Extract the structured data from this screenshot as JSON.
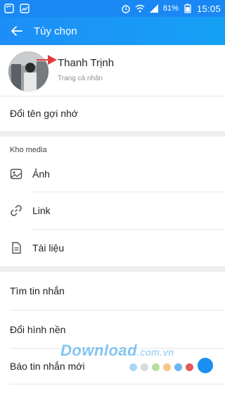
{
  "status_bar": {
    "battery": "81%",
    "time": "15:05"
  },
  "header": {
    "title": "Tùy chọn"
  },
  "profile": {
    "name": "Thanh Trịnh",
    "subtitle": "Trang cá nhân"
  },
  "rename_label": "Đổi tên gợi nhớ",
  "media_section": {
    "label": "Kho media",
    "items": [
      {
        "label": "Ảnh",
        "icon": "image-icon"
      },
      {
        "label": "Link",
        "icon": "link-icon"
      },
      {
        "label": "Tài liệu",
        "icon": "document-icon"
      }
    ]
  },
  "more_items": [
    {
      "label": "Tìm tin nhắn"
    },
    {
      "label": "Đổi hình nền"
    },
    {
      "label": "Báo tin nhắn mới"
    }
  ],
  "watermark": {
    "text": "Download",
    "tld": ".com.vn"
  },
  "colors": {
    "header": "#1a88f4",
    "divider": "#e7e8ea",
    "section_gap": "#eceef0",
    "toggle": "#1b8ff0"
  },
  "dot_colors": [
    "#a8d8f5",
    "#d6dbe0",
    "#b4e0a0",
    "#f5c88a",
    "#6fb5f0",
    "#e05a5a"
  ]
}
